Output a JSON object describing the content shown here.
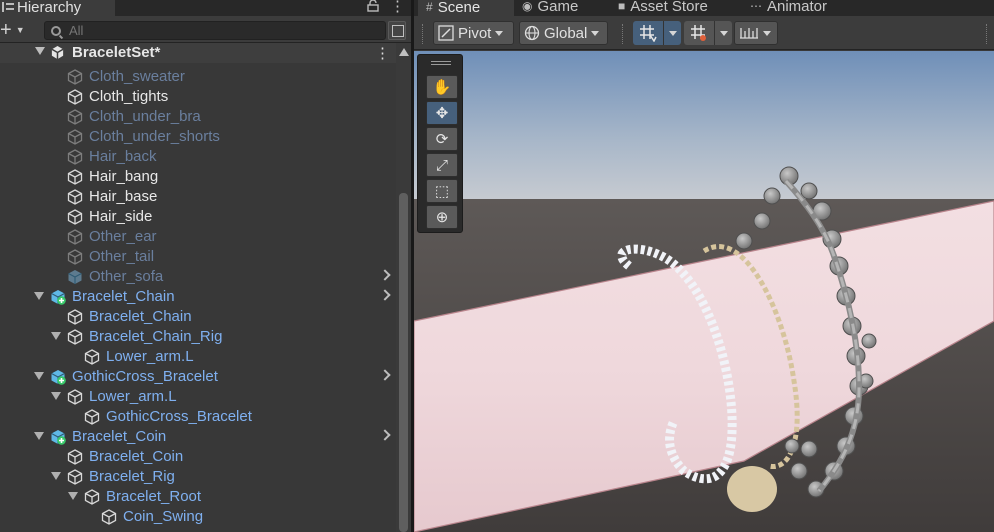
{
  "hierarchy": {
    "tab_title": "Hierarchy",
    "add_label": "+",
    "search_placeholder": "All",
    "scene_name": "BraceletSet*",
    "rows": [
      {
        "label": "Cloth_sweater",
        "depth": 2,
        "state": "dim",
        "icon": "cube-icon",
        "fold": "none"
      },
      {
        "label": "Cloth_tights",
        "depth": 2,
        "state": "active",
        "icon": "cube-icon",
        "fold": "none"
      },
      {
        "label": "Cloth_under_bra",
        "depth": 2,
        "state": "dim",
        "icon": "cube-icon",
        "fold": "none"
      },
      {
        "label": "Cloth_under_shorts",
        "depth": 2,
        "state": "dim",
        "icon": "cube-icon",
        "fold": "none"
      },
      {
        "label": "Hair_back",
        "depth": 2,
        "state": "dim",
        "icon": "cube-icon",
        "fold": "none"
      },
      {
        "label": "Hair_bang",
        "depth": 2,
        "state": "active",
        "icon": "cube-icon",
        "fold": "none"
      },
      {
        "label": "Hair_base",
        "depth": 2,
        "state": "active",
        "icon": "cube-icon",
        "fold": "none"
      },
      {
        "label": "Hair_side",
        "depth": 2,
        "state": "active",
        "icon": "cube-icon",
        "fold": "none"
      },
      {
        "label": "Other_ear",
        "depth": 2,
        "state": "dim",
        "icon": "cube-icon",
        "fold": "none"
      },
      {
        "label": "Other_tail",
        "depth": 2,
        "state": "dim",
        "icon": "cube-icon",
        "fold": "none"
      },
      {
        "label": "Other_sofa",
        "depth": 2,
        "state": "dim",
        "icon": "prefab-icon",
        "fold": "none",
        "arrow": true
      },
      {
        "label": "Bracelet_Chain",
        "depth": 1,
        "state": "prefab",
        "icon": "prefab-added-icon",
        "fold": "open",
        "arrow": true
      },
      {
        "label": "Bracelet_Chain",
        "depth": 2,
        "state": "prefab",
        "icon": "cube-icon",
        "fold": "none"
      },
      {
        "label": "Bracelet_Chain_Rig",
        "depth": 2,
        "state": "prefab",
        "icon": "cube-icon",
        "fold": "open"
      },
      {
        "label": "Lower_arm.L",
        "depth": 3,
        "state": "prefab",
        "icon": "cube-icon",
        "fold": "none"
      },
      {
        "label": "GothicCross_Bracelet",
        "depth": 1,
        "state": "prefab",
        "icon": "prefab-added-icon",
        "fold": "open",
        "arrow": true
      },
      {
        "label": "Lower_arm.L",
        "depth": 2,
        "state": "prefab",
        "icon": "cube-icon",
        "fold": "open"
      },
      {
        "label": "GothicCross_Bracelet",
        "depth": 3,
        "state": "prefab",
        "icon": "cube-icon",
        "fold": "none"
      },
      {
        "label": "Bracelet_Coin",
        "depth": 1,
        "state": "prefab",
        "icon": "prefab-added-icon",
        "fold": "open",
        "arrow": true
      },
      {
        "label": "Bracelet_Coin",
        "depth": 2,
        "state": "prefab",
        "icon": "cube-icon",
        "fold": "none"
      },
      {
        "label": "Bracelet_Rig",
        "depth": 2,
        "state": "prefab",
        "icon": "cube-icon",
        "fold": "open"
      },
      {
        "label": "Bracelet_Root",
        "depth": 3,
        "state": "prefab",
        "icon": "cube-icon",
        "fold": "open"
      },
      {
        "label": "Coin_Swing",
        "depth": 4,
        "state": "prefab",
        "icon": "cube-icon",
        "fold": "none"
      }
    ]
  },
  "scene_panel": {
    "tabs": [
      {
        "label": "Scene",
        "icon": "grid-icon",
        "active": true
      },
      {
        "label": "Game",
        "icon": "gamepad-icon",
        "active": false
      },
      {
        "label": "Asset Store",
        "icon": "bag-icon",
        "active": false
      },
      {
        "label": "Animator",
        "icon": "animator-icon",
        "active": false
      }
    ],
    "pivot_label": "Pivot",
    "global_label": "Global",
    "tools": [
      "hand-tool-icon",
      "move-tool-icon",
      "rotate-tool-icon",
      "scale-tool-icon",
      "rect-tool-icon",
      "transform-tool-icon"
    ],
    "active_tool": "move-tool-icon"
  },
  "colors": {
    "panel_bg": "#383838",
    "active_tab_accent": "#3a79bb",
    "text_active": "#e8e8e8",
    "text_disabled": "#6a7f9e",
    "text_prefab": "#7fb0f0",
    "prefab_icon": "#5fb8e6",
    "added_badge": "#37c86a"
  }
}
